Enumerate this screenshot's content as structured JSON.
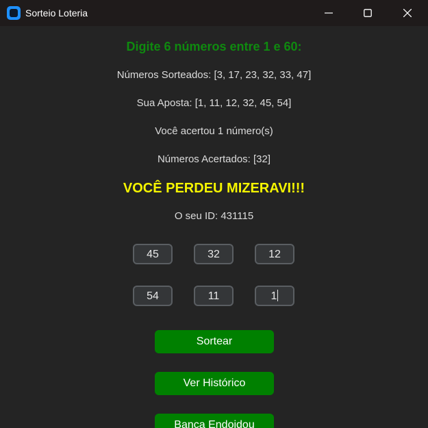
{
  "window": {
    "title": "Sorteio Loteria"
  },
  "main": {
    "heading": "Digite 6 números entre 1 e 60:",
    "drawn_numbers": "Números Sorteados: [3, 17, 23, 32, 33, 47]",
    "bet": "Sua Aposta: [1, 11, 12, 32, 45, 54]",
    "hits_count": "Você acertou 1 número(s)",
    "hit_numbers": "Números Acertados: [32]",
    "result": "VOCÊ PERDEU MIZERAVI!!!",
    "user_id": "O seu ID: 431115",
    "inputs": [
      "45",
      "32",
      "12",
      "54",
      "11",
      "1"
    ]
  },
  "buttons": {
    "draw": "Sortear",
    "history": "Ver Histórico",
    "bank": "Banca Endoidou"
  },
  "colors": {
    "background": "#242424",
    "heading": "#0f8a0f",
    "result": "#f5f500",
    "button": "#008000",
    "input_border": "#5a5e62"
  },
  "icons": {
    "app": "app-icon",
    "minimize": "minimize-icon",
    "maximize": "maximize-icon",
    "close": "close-icon"
  }
}
